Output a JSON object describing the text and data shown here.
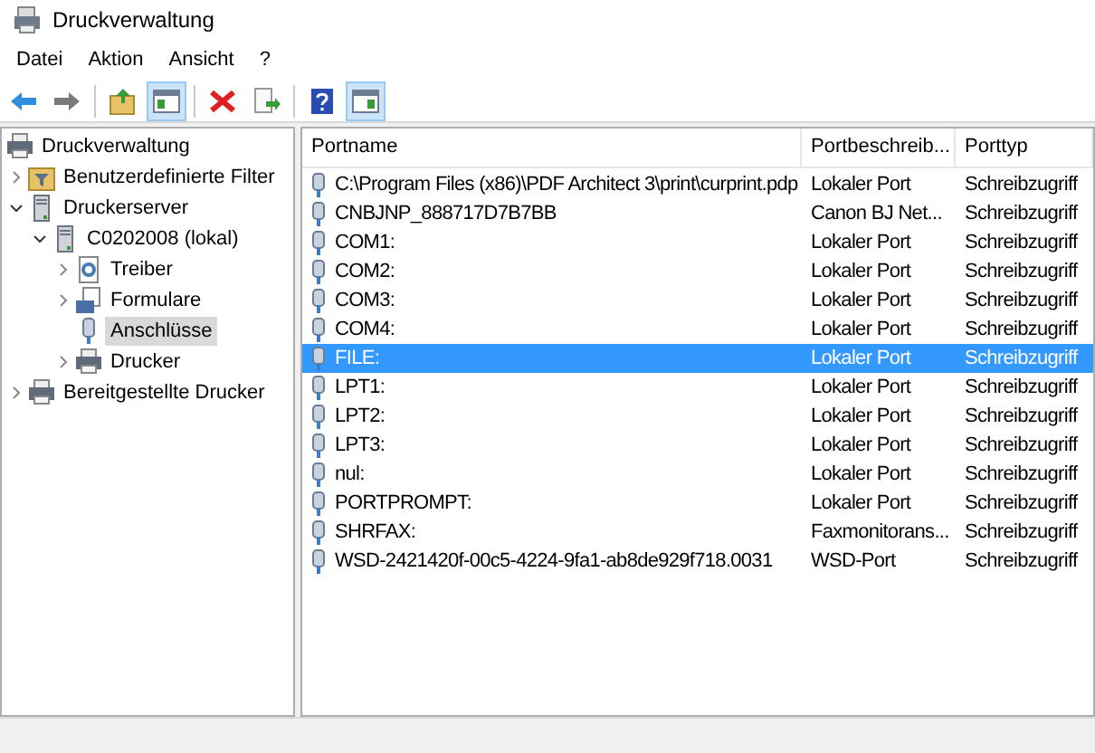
{
  "window": {
    "title": "Druckverwaltung"
  },
  "menu": [
    "Datei",
    "Aktion",
    "Ansicht",
    "?"
  ],
  "toolbar": [
    {
      "kind": "back",
      "pressed": false
    },
    {
      "kind": "forward",
      "pressed": false
    },
    {
      "kind": "sep"
    },
    {
      "kind": "up",
      "pressed": false
    },
    {
      "kind": "tree",
      "pressed": true
    },
    {
      "kind": "sep"
    },
    {
      "kind": "delete",
      "pressed": false
    },
    {
      "kind": "export",
      "pressed": false
    },
    {
      "kind": "sep"
    },
    {
      "kind": "help",
      "pressed": false
    },
    {
      "kind": "pane",
      "pressed": true
    }
  ],
  "tree": [
    {
      "label": "Druckverwaltung",
      "kind": "printer",
      "selected": false,
      "children": [
        {
          "label": "Benutzerdefinierte Filter",
          "kind": "filter",
          "expanded": false,
          "selected": false
        },
        {
          "label": "Druckerserver",
          "kind": "server",
          "expanded": true,
          "selected": false,
          "children": [
            {
              "label": "C0202008 (lokal)",
              "kind": "server",
              "expanded": true,
              "selected": false,
              "children": [
                {
                  "label": "Treiber",
                  "kind": "driver",
                  "expanded": false,
                  "selected": false
                },
                {
                  "label": "Formulare",
                  "kind": "forms",
                  "expanded": false,
                  "selected": false
                },
                {
                  "label": "Anschlüsse",
                  "kind": "port",
                  "selected": true
                },
                {
                  "label": "Drucker",
                  "kind": "printer",
                  "expanded": false,
                  "selected": false
                }
              ]
            }
          ]
        },
        {
          "label": "Bereitgestellte Drucker",
          "kind": "printer",
          "expanded": false,
          "selected": false
        }
      ]
    }
  ],
  "table": {
    "columns": [
      "Portname",
      "Portbeschreib...",
      "Porttyp"
    ],
    "rows": [
      {
        "cells": [
          "C:\\Program Files (x86)\\PDF Architect 3\\print\\curprint.pdp",
          "Lokaler Port",
          "Schreibzugriff"
        ],
        "selected": false
      },
      {
        "cells": [
          "CNBJNP_888717D7B7BB",
          "Canon BJ Net...",
          "Schreibzugriff"
        ],
        "selected": false
      },
      {
        "cells": [
          "COM1:",
          "Lokaler Port",
          "Schreibzugriff"
        ],
        "selected": false
      },
      {
        "cells": [
          "COM2:",
          "Lokaler Port",
          "Schreibzugriff"
        ],
        "selected": false
      },
      {
        "cells": [
          "COM3:",
          "Lokaler Port",
          "Schreibzugriff"
        ],
        "selected": false
      },
      {
        "cells": [
          "COM4:",
          "Lokaler Port",
          "Schreibzugriff"
        ],
        "selected": false
      },
      {
        "cells": [
          "FILE:",
          "Lokaler Port",
          "Schreibzugriff"
        ],
        "selected": true
      },
      {
        "cells": [
          "LPT1:",
          "Lokaler Port",
          "Schreibzugriff"
        ],
        "selected": false
      },
      {
        "cells": [
          "LPT2:",
          "Lokaler Port",
          "Schreibzugriff"
        ],
        "selected": false
      },
      {
        "cells": [
          "LPT3:",
          "Lokaler Port",
          "Schreibzugriff"
        ],
        "selected": false
      },
      {
        "cells": [
          "nul:",
          "Lokaler Port",
          "Schreibzugriff"
        ],
        "selected": false
      },
      {
        "cells": [
          "PORTPROMPT:",
          "Lokaler Port",
          "Schreibzugriff"
        ],
        "selected": false
      },
      {
        "cells": [
          "SHRFAX:",
          "Faxmonitorans...",
          "Schreibzugriff"
        ],
        "selected": false
      },
      {
        "cells": [
          "WSD-2421420f-00c5-4224-9fa1-ab8de929f718.0031",
          "WSD-Port",
          "Schreibzugriff"
        ],
        "selected": false
      }
    ]
  }
}
